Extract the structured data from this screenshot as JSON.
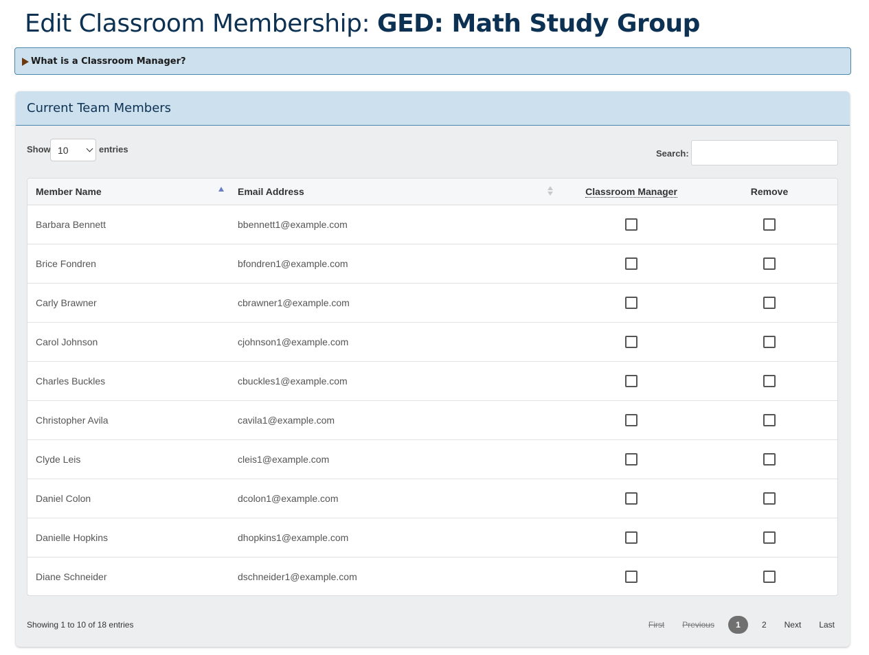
{
  "page": {
    "title_prefix": "Edit Classroom Membership: ",
    "title_classroom": "GED: Math Study Group"
  },
  "details": {
    "summary": "What is a Classroom Manager?"
  },
  "card": {
    "title": "Current Team Members"
  },
  "length": {
    "show_label": "Show",
    "value": "10",
    "entries_label": "entries"
  },
  "search": {
    "label": "Search:",
    "value": ""
  },
  "table": {
    "headers": {
      "name": "Member Name",
      "email": "Email Address",
      "manager": "Classroom Manager",
      "remove": "Remove"
    },
    "rows": [
      {
        "name": "Barbara Bennett",
        "email": "bbennett1@example.com"
      },
      {
        "name": "Brice Fondren",
        "email": "bfondren1@example.com"
      },
      {
        "name": "Carly Brawner",
        "email": "cbrawner1@example.com"
      },
      {
        "name": "Carol Johnson",
        "email": "cjohnson1@example.com"
      },
      {
        "name": "Charles Buckles",
        "email": "cbuckles1@example.com"
      },
      {
        "name": "Christopher Avila",
        "email": "cavila1@example.com"
      },
      {
        "name": "Clyde Leis",
        "email": "cleis1@example.com"
      },
      {
        "name": "Daniel Colon",
        "email": "dcolon1@example.com"
      },
      {
        "name": "Danielle Hopkins",
        "email": "dhopkins1@example.com"
      },
      {
        "name": "Diane Schneider",
        "email": "dschneider1@example.com"
      }
    ]
  },
  "info": "Showing 1 to 10 of 18 entries",
  "pagination": {
    "first": "First",
    "previous": "Previous",
    "page1": "1",
    "page2": "2",
    "next": "Next",
    "last": "Last"
  }
}
